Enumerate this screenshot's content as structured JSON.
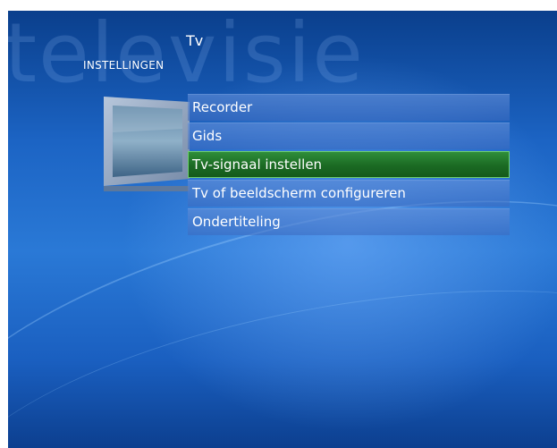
{
  "header": {
    "watermark": "televisie",
    "title": "Tv",
    "section": "INSTELLINGEN"
  },
  "menu": {
    "items": [
      {
        "label": "Recorder",
        "selected": false
      },
      {
        "label": "Gids",
        "selected": false
      },
      {
        "label": "Tv-signaal instellen",
        "selected": true
      },
      {
        "label": "Tv of beeldscherm configureren",
        "selected": false
      },
      {
        "label": "Ondertiteling",
        "selected": false
      }
    ]
  },
  "colors": {
    "background": "#1c64c4",
    "selected": "#1b6a23",
    "item": "#4a78c8"
  },
  "icons": {
    "tv": "television-icon"
  }
}
